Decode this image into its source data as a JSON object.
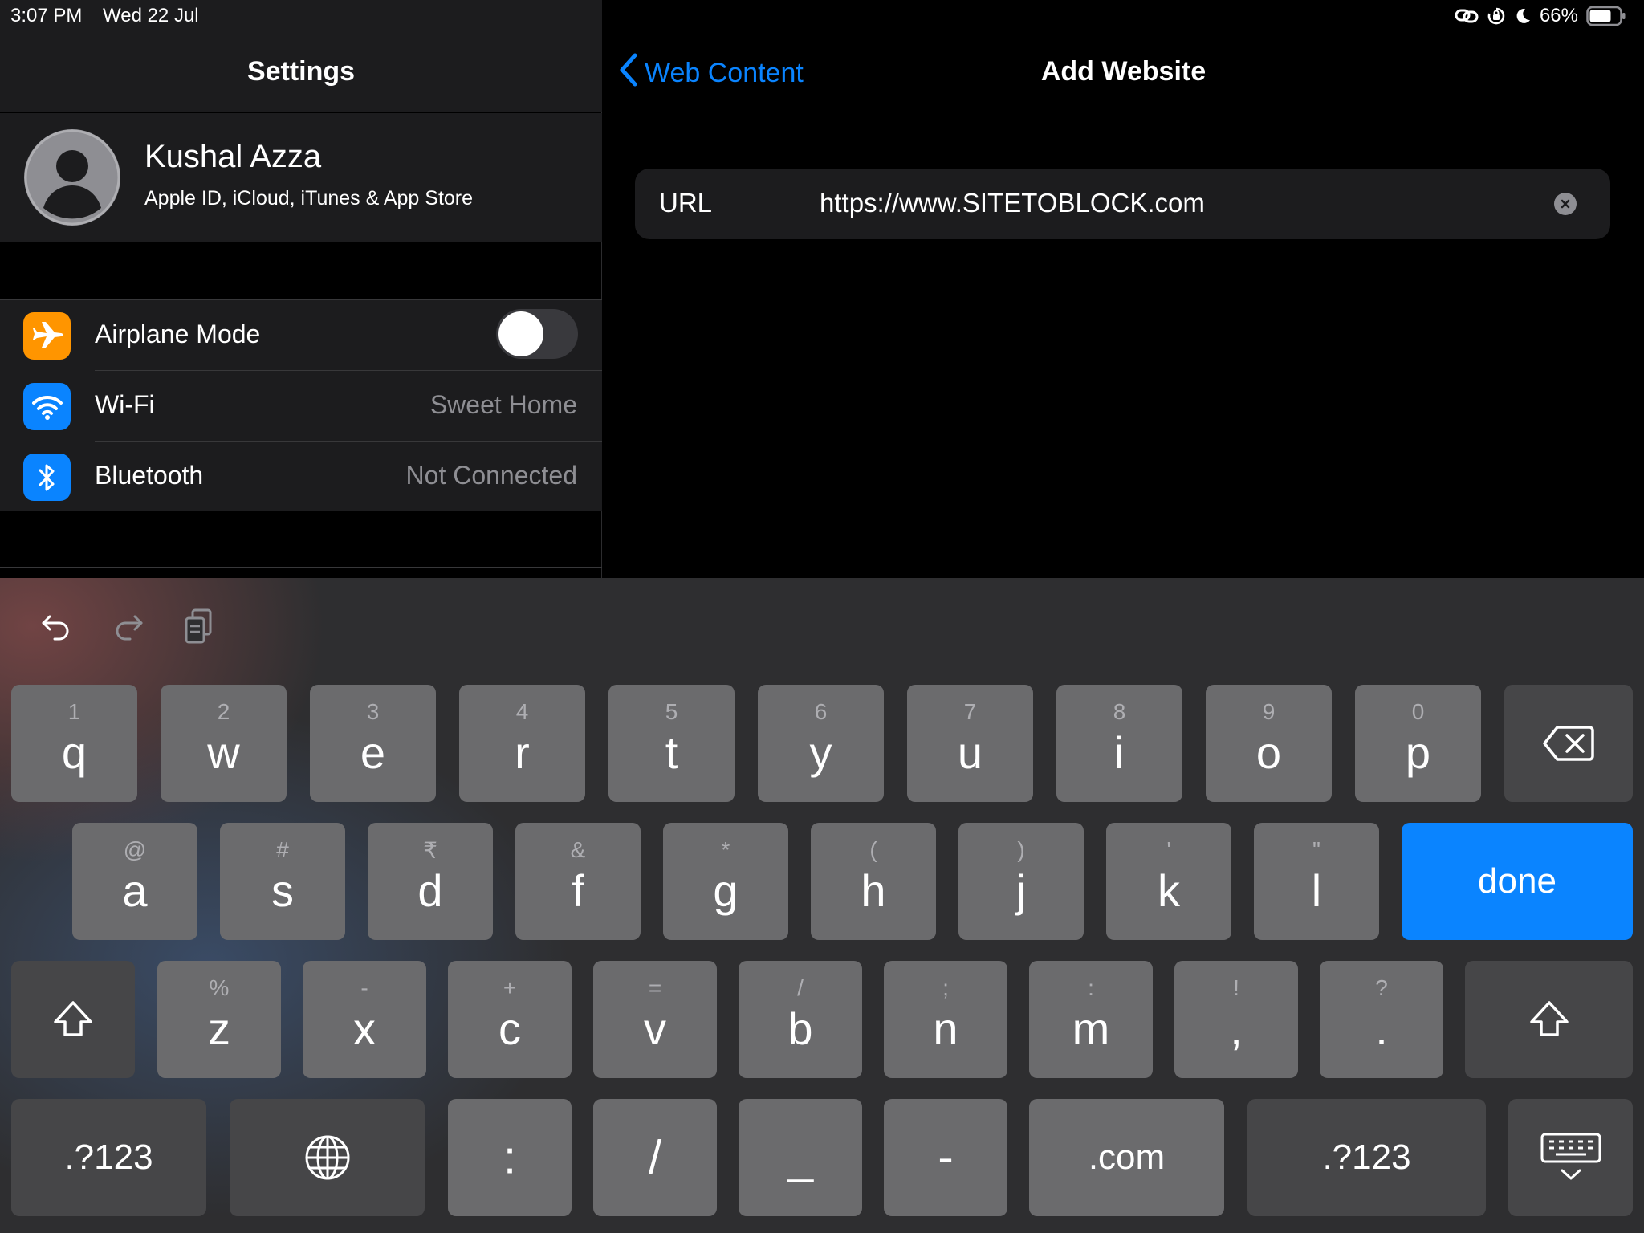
{
  "status_bar": {
    "time": "3:07 PM",
    "date": "Wed 22 Jul",
    "battery": "66%"
  },
  "settings": {
    "title": "Settings",
    "profile": {
      "name": "Kushal Azza",
      "subtitle": "Apple ID, iCloud, iTunes & App Store"
    },
    "rows": [
      {
        "label": "Airplane Mode",
        "value": "",
        "icon": "airplane-icon",
        "color": "#ff9500"
      },
      {
        "label": "Wi-Fi",
        "value": "Sweet Home",
        "icon": "wifi-icon",
        "color": "#0a84ff"
      },
      {
        "label": "Bluetooth",
        "value": "Not Connected",
        "icon": "bluetooth-icon",
        "color": "#0a84ff"
      }
    ]
  },
  "detail": {
    "back_label": "Web Content",
    "title": "Add Website",
    "url_label": "URL",
    "url_value": "https://www.SITETOBLOCK.com"
  },
  "keyboard": {
    "row1": [
      {
        "alt": "1",
        "main": "q"
      },
      {
        "alt": "2",
        "main": "w"
      },
      {
        "alt": "3",
        "main": "e"
      },
      {
        "alt": "4",
        "main": "r"
      },
      {
        "alt": "5",
        "main": "t"
      },
      {
        "alt": "6",
        "main": "y"
      },
      {
        "alt": "7",
        "main": "u"
      },
      {
        "alt": "8",
        "main": "i"
      },
      {
        "alt": "9",
        "main": "o"
      },
      {
        "alt": "0",
        "main": "p"
      }
    ],
    "row2": [
      {
        "alt": "@",
        "main": "a"
      },
      {
        "alt": "#",
        "main": "s"
      },
      {
        "alt": "₹",
        "main": "d"
      },
      {
        "alt": "&",
        "main": "f"
      },
      {
        "alt": "*",
        "main": "g"
      },
      {
        "alt": "(",
        "main": "h"
      },
      {
        "alt": ")",
        "main": "j"
      },
      {
        "alt": "'",
        "main": "k"
      },
      {
        "alt": "\"",
        "main": "l"
      }
    ],
    "row3": [
      {
        "alt": "%",
        "main": "z"
      },
      {
        "alt": "-",
        "main": "x"
      },
      {
        "alt": "+",
        "main": "c"
      },
      {
        "alt": "=",
        "main": "v"
      },
      {
        "alt": "/",
        "main": "b"
      },
      {
        "alt": ";",
        "main": "n"
      },
      {
        "alt": ":",
        "main": "m"
      },
      {
        "alt": "!",
        "main": ","
      },
      {
        "alt": "?",
        "main": "."
      }
    ],
    "done": "done",
    "numbers_left": ".?123",
    "numbers_right": ".?123",
    "bottom": [
      ":",
      "/",
      "_",
      "-",
      ".com"
    ]
  }
}
